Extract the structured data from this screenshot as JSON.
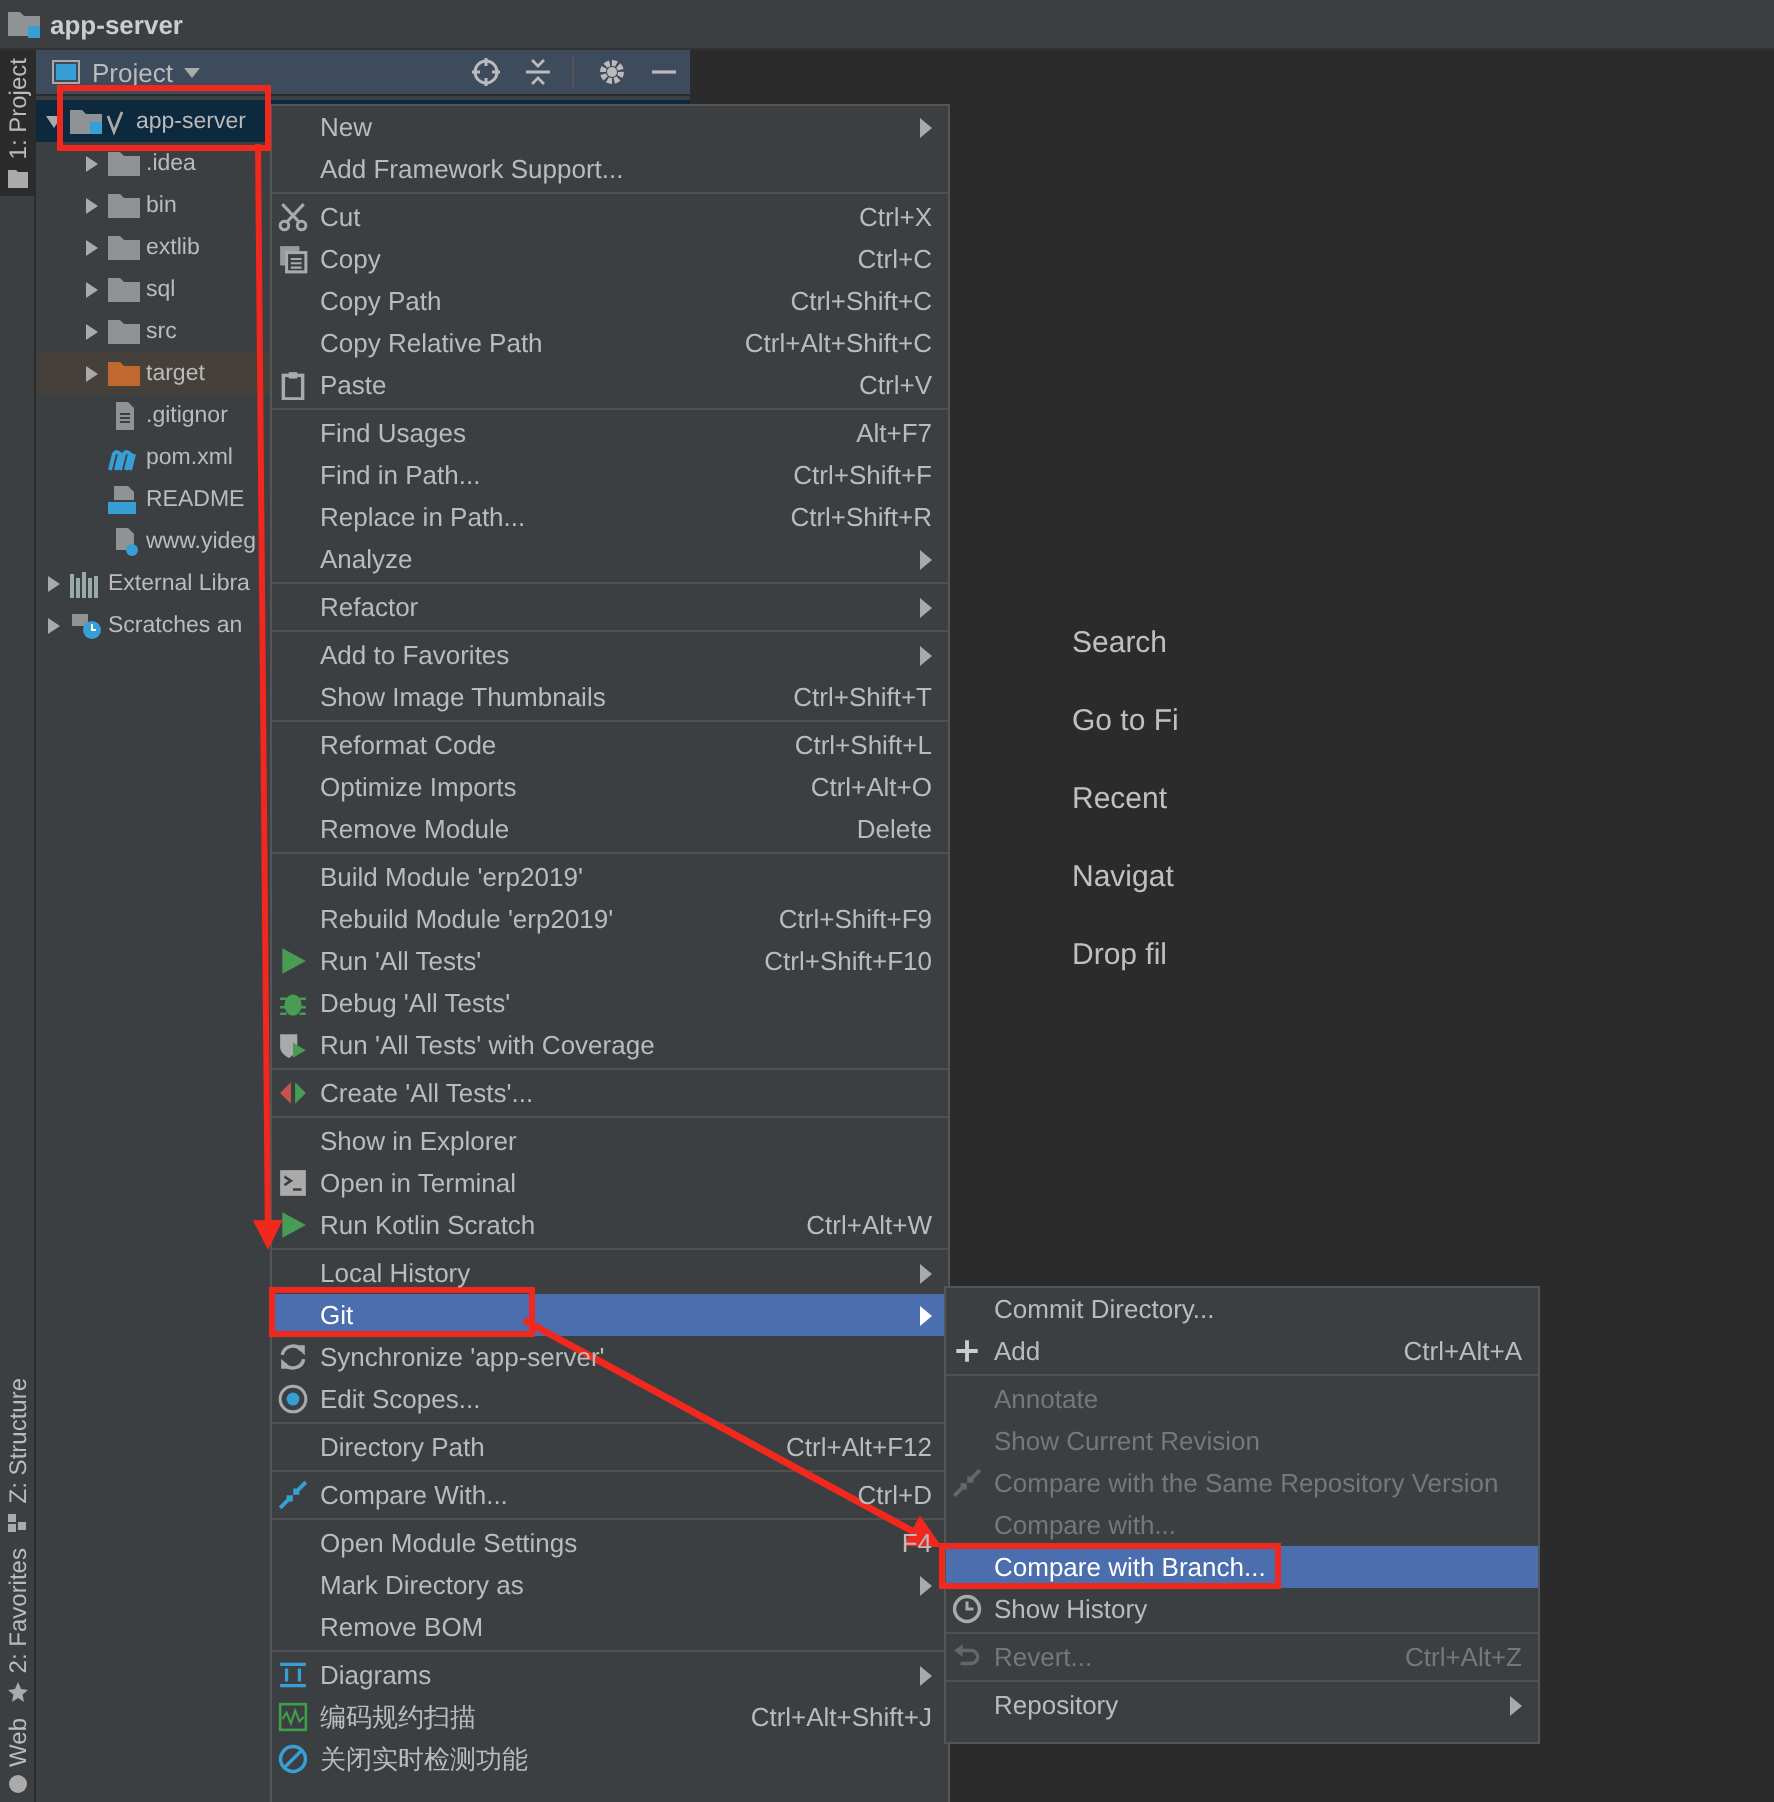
{
  "window": {
    "title": "app-server"
  },
  "tool_strip": [
    {
      "label": "1: Project",
      "kind": "folder",
      "selected": true
    },
    {
      "label": "Z: Structure",
      "kind": "structure",
      "selected": false
    },
    {
      "label": "2: Favorites",
      "kind": "star",
      "selected": false
    },
    {
      "label": "Web",
      "kind": "web",
      "selected": false
    }
  ],
  "project_panel": {
    "title": "Project"
  },
  "tree": [
    {
      "label": "app-server",
      "kind": "module",
      "expanded": true,
      "selected": true,
      "children": [
        {
          "label": ".idea",
          "kind": "folder",
          "expanded": false
        },
        {
          "label": "bin",
          "kind": "folder",
          "expanded": false
        },
        {
          "label": "extlib",
          "kind": "folder",
          "expanded": false
        },
        {
          "label": "sql",
          "kind": "folder",
          "expanded": false
        },
        {
          "label": "src",
          "kind": "folder",
          "expanded": false
        },
        {
          "label": "target",
          "kind": "excluded",
          "expanded": false
        },
        {
          "label": ".gitignor",
          "kind": "file"
        },
        {
          "label": "pom.xml",
          "kind": "maven"
        },
        {
          "label": "README",
          "kind": "markdown"
        },
        {
          "label": "www.yideg",
          "kind": "unknown"
        }
      ]
    },
    {
      "label": "External Libra",
      "kind": "libraries",
      "expanded": false
    },
    {
      "label": "Scratches an",
      "kind": "scratches",
      "expanded": false
    }
  ],
  "editor_hints": [
    "Search",
    "Go to Fi",
    "Recent",
    "Navigat",
    "Drop fil"
  ],
  "context_menu": {
    "groups": [
      [
        {
          "label": "New",
          "submenu": true
        },
        {
          "label": "Add Framework Support..."
        }
      ],
      [
        {
          "label": "Cut",
          "shortcut": "Ctrl+X",
          "kind": "cut"
        },
        {
          "label": "Copy",
          "shortcut": "Ctrl+C",
          "kind": "copy"
        },
        {
          "label": "Copy Path",
          "shortcut": "Ctrl+Shift+C"
        },
        {
          "label": "Copy Relative Path",
          "shortcut": "Ctrl+Alt+Shift+C"
        },
        {
          "label": "Paste",
          "shortcut": "Ctrl+V",
          "kind": "paste"
        }
      ],
      [
        {
          "label": "Find Usages",
          "shortcut": "Alt+F7"
        },
        {
          "label": "Find in Path...",
          "shortcut": "Ctrl+Shift+F"
        },
        {
          "label": "Replace in Path...",
          "shortcut": "Ctrl+Shift+R"
        },
        {
          "label": "Analyze",
          "submenu": true
        }
      ],
      [
        {
          "label": "Refactor",
          "submenu": true
        }
      ],
      [
        {
          "label": "Add to Favorites",
          "submenu": true
        },
        {
          "label": "Show Image Thumbnails",
          "shortcut": "Ctrl+Shift+T"
        }
      ],
      [
        {
          "label": "Reformat Code",
          "shortcut": "Ctrl+Shift+L"
        },
        {
          "label": "Optimize Imports",
          "shortcut": "Ctrl+Alt+O"
        },
        {
          "label": "Remove Module",
          "shortcut": "Delete"
        }
      ],
      [
        {
          "label": "Build Module 'erp2019'"
        },
        {
          "label": "Rebuild Module 'erp2019'",
          "shortcut": "Ctrl+Shift+F9"
        },
        {
          "label": "Run 'All Tests'",
          "shortcut": "Ctrl+Shift+F10",
          "kind": "run"
        },
        {
          "label": "Debug 'All Tests'",
          "kind": "debug"
        },
        {
          "label": "Run 'All Tests' with Coverage",
          "kind": "coverage"
        }
      ],
      [
        {
          "label": "Create 'All Tests'...",
          "kind": "create"
        }
      ],
      [
        {
          "label": "Show in Explorer"
        },
        {
          "label": "Open in Terminal",
          "kind": "terminal"
        },
        {
          "label": "Run Kotlin Scratch",
          "shortcut": "Ctrl+Alt+W",
          "kind": "run"
        }
      ],
      [
        {
          "label": "Local History",
          "submenu": true
        },
        {
          "label": "Git",
          "submenu": true,
          "selected": true
        },
        {
          "label": "Synchronize 'app-server'",
          "kind": "sync"
        },
        {
          "label": "Edit Scopes...",
          "kind": "scope"
        }
      ],
      [
        {
          "label": "Directory Path",
          "shortcut": "Ctrl+Alt+F12"
        }
      ],
      [
        {
          "label": "Compare With...",
          "shortcut": "Ctrl+D",
          "kind": "compare"
        }
      ],
      [
        {
          "label": "Open Module Settings",
          "shortcut": "F4"
        },
        {
          "label": "Mark Directory as",
          "submenu": true
        },
        {
          "label": "Remove BOM"
        }
      ],
      [
        {
          "label": "Diagrams",
          "submenu": true,
          "kind": "diagram"
        },
        {
          "label": "编码规约扫描",
          "shortcut": "Ctrl+Alt+Shift+J",
          "kind": "scan"
        },
        {
          "label": "关闭实时检测功能",
          "kind": "forbid"
        }
      ]
    ]
  },
  "git_submenu": {
    "groups": [
      [
        {
          "label": "Commit Directory..."
        },
        {
          "label": "Add",
          "shortcut": "Ctrl+Alt+A",
          "kind": "plus"
        }
      ],
      [
        {
          "label": "Annotate",
          "disabled": true
        },
        {
          "label": "Show Current Revision",
          "disabled": true
        },
        {
          "label": "Compare with the Same Repository Version",
          "disabled": true,
          "kind": "compare"
        },
        {
          "label": "Compare with...",
          "disabled": true
        },
        {
          "label": "Compare with Branch...",
          "selected": true
        },
        {
          "label": "Show History",
          "kind": "clock"
        }
      ],
      [
        {
          "label": "Revert...",
          "shortcut": "Ctrl+Alt+Z",
          "disabled": true,
          "kind": "revert"
        }
      ],
      [
        {
          "label": "Repository",
          "submenu": true
        }
      ]
    ]
  }
}
